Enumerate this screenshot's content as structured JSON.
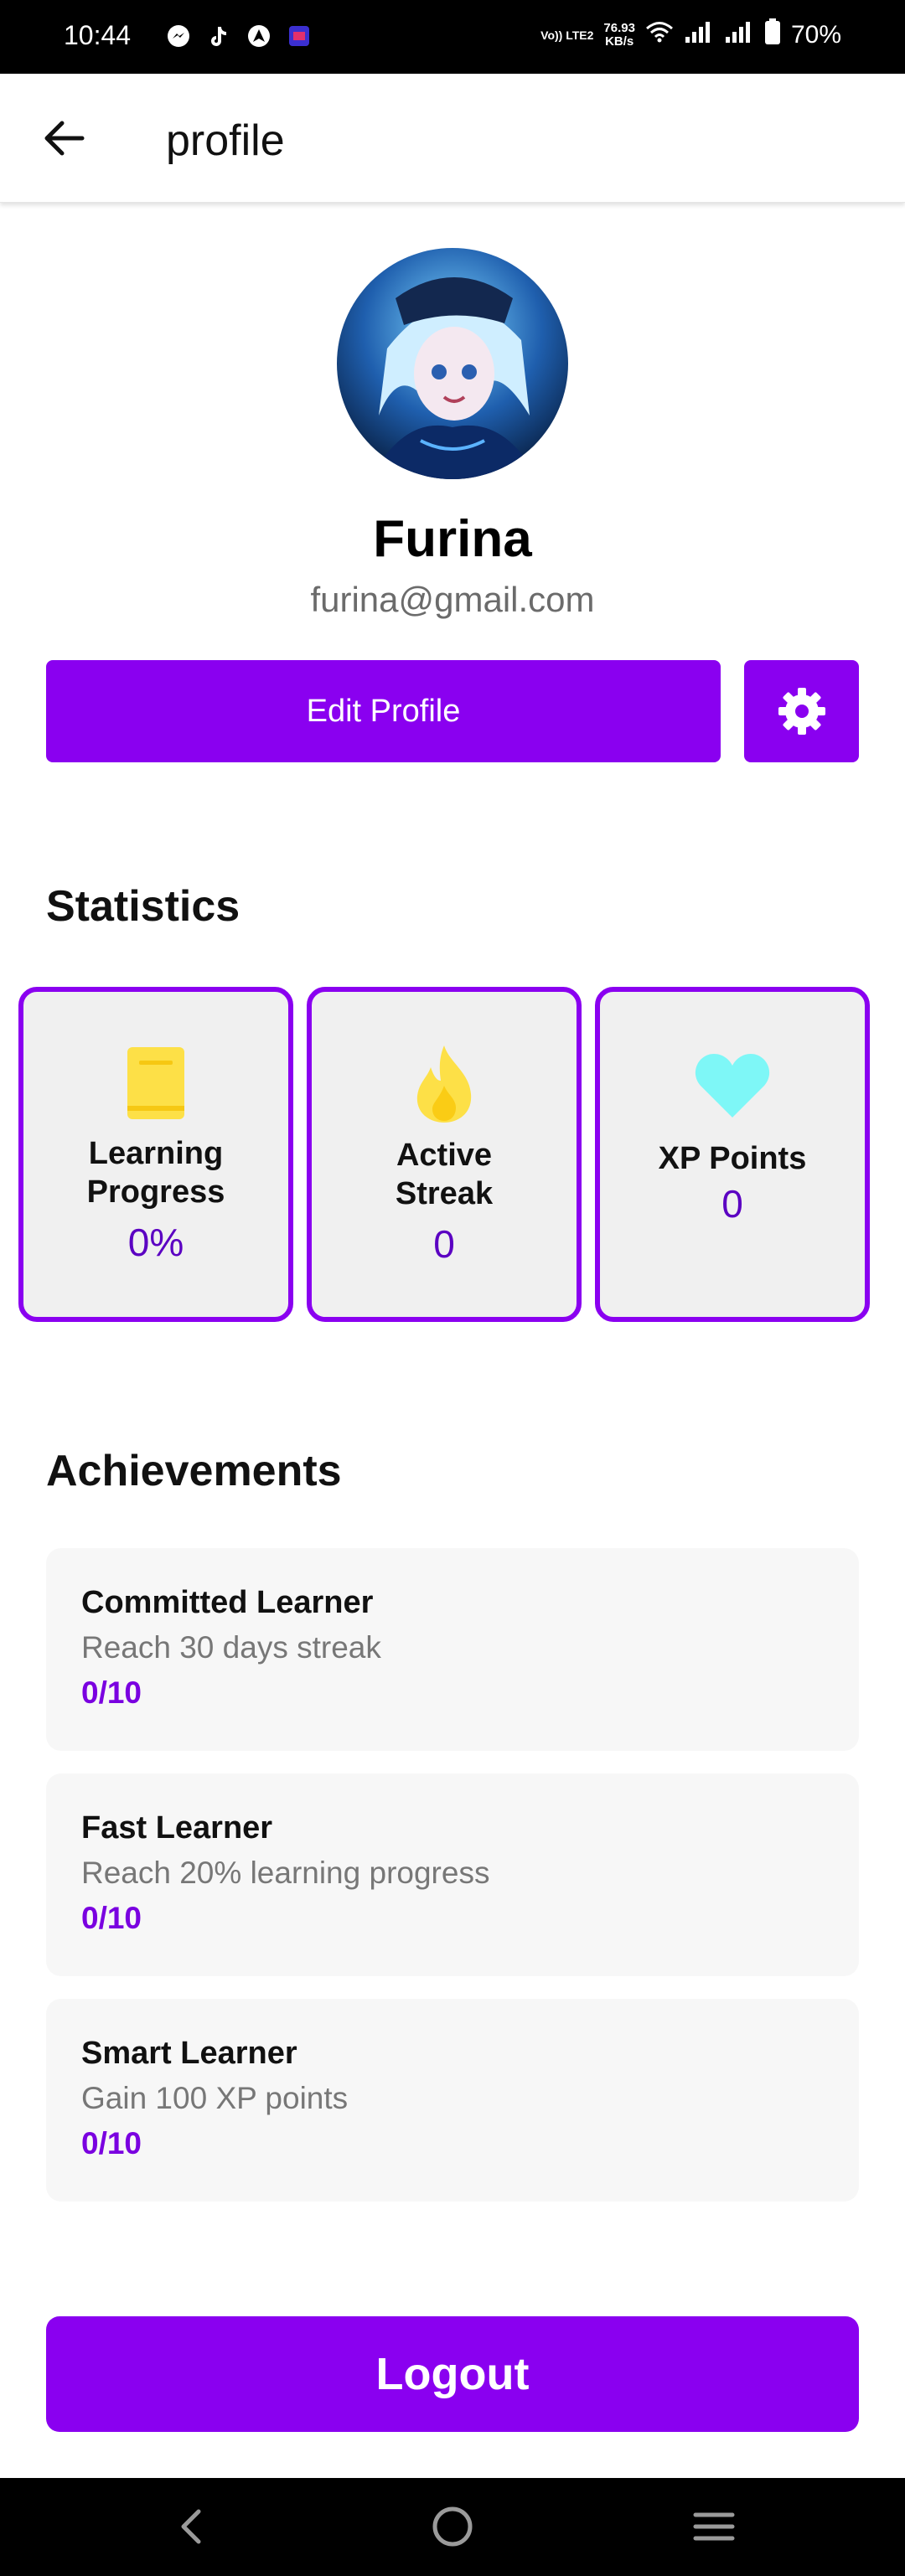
{
  "status_bar": {
    "time": "10:44",
    "volte": "Vo)) LTE2",
    "speed_value": "76.93",
    "speed_unit": "KB/s",
    "battery": "70%"
  },
  "app_bar": {
    "title": "profile"
  },
  "profile": {
    "name": "Furina",
    "email": "furina@gmail.com",
    "edit_label": "Edit Profile"
  },
  "statistics": {
    "title": "Statistics",
    "cards": [
      {
        "label_line1": "Learning",
        "label_line2": "Progress",
        "value": "0%",
        "icon": "book-icon",
        "icon_color": "#fde047"
      },
      {
        "label_line1": "Active",
        "label_line2": "Streak",
        "value": "0",
        "icon": "flame-icon",
        "icon_color": "#fde047"
      },
      {
        "label_line1": "XP Points",
        "label_line2": "",
        "value": "0",
        "icon": "heart-icon",
        "icon_color": "#7ef7f7"
      }
    ]
  },
  "achievements": {
    "title": "Achievements",
    "items": [
      {
        "title": "Committed Learner",
        "description": "Reach 30 days streak",
        "progress": "0/10"
      },
      {
        "title": "Fast Learner",
        "description": "Reach 20% learning progress",
        "progress": "0/10"
      },
      {
        "title": "Smart Learner",
        "description": "Gain 100 XP points",
        "progress": "0/10"
      }
    ]
  },
  "logout_label": "Logout",
  "colors": {
    "accent": "#8a00f0",
    "stat_value": "#5b00c2"
  }
}
